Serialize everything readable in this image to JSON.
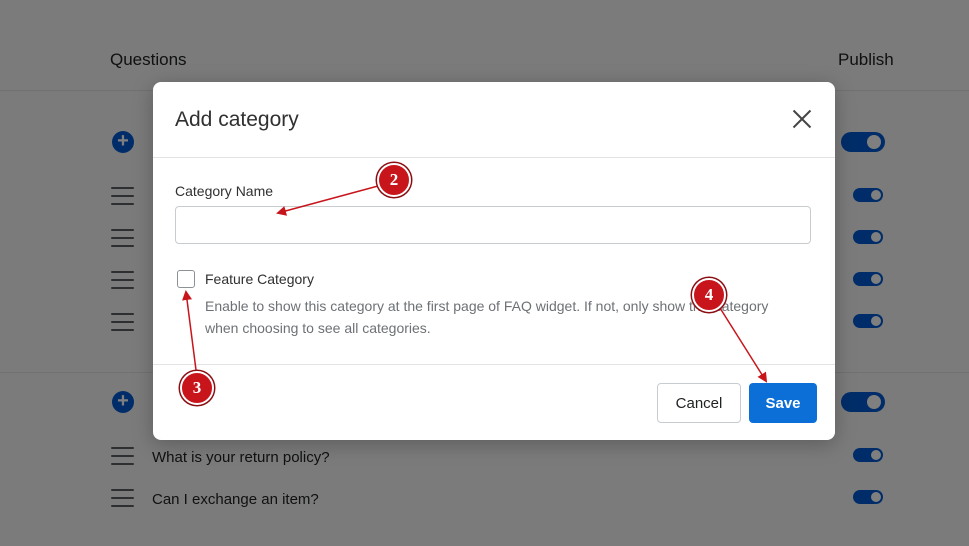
{
  "background": {
    "columns": {
      "questions": "Questions",
      "publish": "Publish"
    },
    "rows": [
      {
        "text": "What is your return policy?"
      },
      {
        "text": "Can I exchange an item?"
      }
    ]
  },
  "modal": {
    "title": "Add category",
    "category_name": {
      "label": "Category Name",
      "value": "",
      "placeholder": ""
    },
    "feature_category": {
      "label": "Feature Category",
      "checked": false,
      "help": "Enable to show this category at the first page of FAQ widget. If not, only show this category when choosing to see all categories."
    },
    "buttons": {
      "cancel": "Cancel",
      "save": "Save"
    }
  },
  "annotations": [
    {
      "number": "2"
    },
    {
      "number": "3"
    },
    {
      "number": "4"
    }
  ],
  "colors": {
    "primary": "#0c6fd8",
    "marker": "#c8151c",
    "toggle": "#005bd3"
  }
}
